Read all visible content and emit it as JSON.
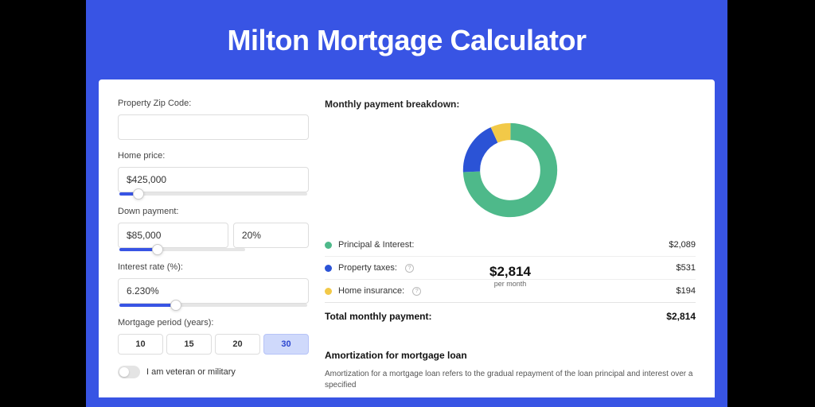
{
  "page_title": "Milton Mortgage Calculator",
  "form": {
    "zip": {
      "label": "Property Zip Code:",
      "value": ""
    },
    "price": {
      "label": "Home price:",
      "value": "$425,000",
      "slider_pct": 10
    },
    "down": {
      "label": "Down payment:",
      "amount": "$85,000",
      "percent": "20%",
      "slider_pct": 20
    },
    "rate": {
      "label": "Interest rate (%):",
      "value": "6.230%",
      "slider_pct": 30
    },
    "period": {
      "label": "Mortgage period (years):",
      "options": [
        "10",
        "15",
        "20",
        "30"
      ],
      "selected": "30"
    },
    "veteran": {
      "label": "I am veteran or military",
      "on": false
    }
  },
  "breakdown": {
    "title": "Monthly payment breakdown:",
    "center_amount": "$2,814",
    "center_sub": "per month",
    "items": [
      {
        "label": "Principal & Interest:",
        "value": "$2,089",
        "color": "#4eb98a",
        "info": false
      },
      {
        "label": "Property taxes:",
        "value": "$531",
        "color": "#2b53d6",
        "info": true
      },
      {
        "label": "Home insurance:",
        "value": "$194",
        "color": "#f2c948",
        "info": true
      }
    ],
    "total_label": "Total monthly payment:",
    "total_value": "$2,814"
  },
  "chart_data": {
    "type": "pie",
    "title": "Monthly payment breakdown",
    "series": [
      {
        "name": "Principal & Interest",
        "value": 2089,
        "color": "#4eb98a"
      },
      {
        "name": "Property taxes",
        "value": 531,
        "color": "#2b53d6"
      },
      {
        "name": "Home insurance",
        "value": 194,
        "color": "#f2c948"
      }
    ],
    "total": 2814,
    "center_label": "$2,814 per month"
  },
  "amortization": {
    "title": "Amortization for mortgage loan",
    "text": "Amortization for a mortgage loan refers to the gradual repayment of the loan principal and interest over a specified"
  }
}
